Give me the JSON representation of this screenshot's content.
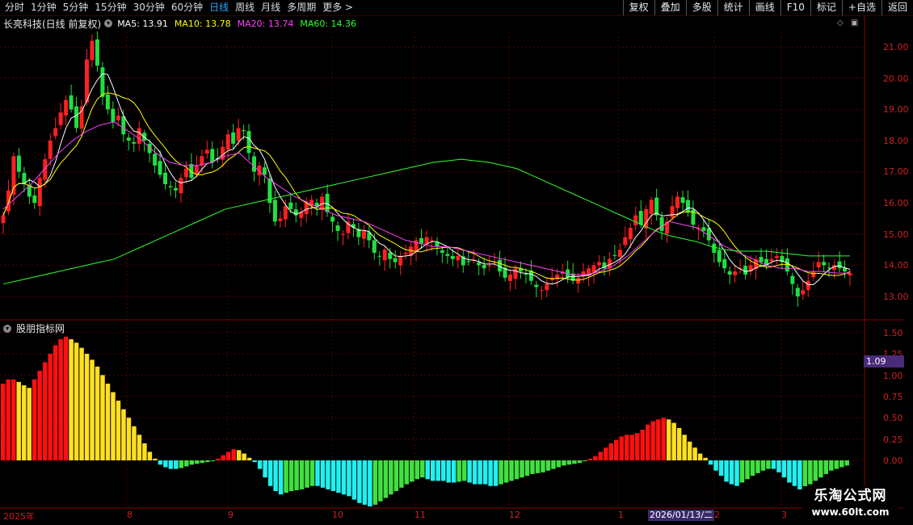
{
  "toolbar": {
    "periods": [
      "分时",
      "1分钟",
      "5分钟",
      "15分钟",
      "30分钟",
      "60分钟",
      "日线",
      "周线",
      "月线",
      "多周期",
      "更多"
    ],
    "active_period": "日线",
    "more_arrow": ">",
    "actions": [
      "复权",
      "叠加",
      "多股",
      "统计",
      "画线",
      "F10",
      "标记",
      "+自选",
      "返回"
    ]
  },
  "info": {
    "stock_name": "长亮科技(日线 前复权)",
    "ma5": "MA5: 13.91",
    "ma10": "MA10: 13.78",
    "ma20": "MA20: 13.74",
    "ma60": "MA60: 14.36",
    "colors": {
      "ma5": "#ffffff",
      "ma10": "#ffff00",
      "ma20": "#ff40ff",
      "ma60": "#30ff30"
    }
  },
  "price_axis": {
    "ticks": [
      "21.00",
      "20.00",
      "19.00",
      "18.00",
      "17.00",
      "16.00",
      "15.00",
      "14.00",
      "13.00"
    ]
  },
  "indicator": {
    "title": "股朋指标网",
    "current_value": "1.09",
    "ticks": [
      "1.50",
      "1.25",
      "1.00",
      "0.75",
      "0.50",
      "0.25",
      "0.00"
    ]
  },
  "date_axis": {
    "labels": [
      "2025年",
      "8",
      "9",
      "10",
      "11",
      "12",
      "1",
      "2",
      "3"
    ],
    "cursor_date": "2026/01/13/二"
  },
  "watermark": {
    "line1": "乐淘公式网",
    "line2": "www.60lt.com"
  },
  "chart_data": {
    "type": "candlestick",
    "colors": {
      "up": "#ff2020",
      "down": "#20e040",
      "ind_red": "#ff1010",
      "ind_yellow": "#ffe020",
      "ind_cyan": "#20f0f0",
      "ind_green": "#40e040"
    },
    "price_range": [
      12.7,
      21.6
    ],
    "closes": [
      15.6,
      16.4,
      17.5,
      17.0,
      16.6,
      16.2,
      16.0,
      16.8,
      17.4,
      18.0,
      18.4,
      18.9,
      19.3,
      19.0,
      18.4,
      19.1,
      20.6,
      21.2,
      20.4,
      19.4,
      19.0,
      18.6,
      18.8,
      18.2,
      18.0,
      17.9,
      18.4,
      18.0,
      17.6,
      17.2,
      16.9,
      16.6,
      16.5,
      16.4,
      16.8,
      17.1,
      16.8,
      17.2,
      17.5,
      17.7,
      17.3,
      17.4,
      17.8,
      18.2,
      17.9,
      18.4,
      18.3,
      17.6,
      17.0,
      17.2,
      16.9,
      16.0,
      15.4,
      15.5,
      15.9,
      15.8,
      15.6,
      15.7,
      16.0,
      16.1,
      15.9,
      16.2,
      15.7,
      15.4,
      15.1,
      15.0,
      15.4,
      15.2,
      14.9,
      15.1,
      14.8,
      14.4,
      14.3,
      14.5,
      14.2,
      14.1,
      14.3,
      14.4,
      14.6,
      14.8,
      14.7,
      14.9,
      14.8,
      14.6,
      14.4,
      14.3,
      14.2,
      14.3,
      14.0,
      14.1,
      14.2,
      14.0,
      13.9,
      14.0,
      14.1,
      13.8,
      13.6,
      13.7,
      13.9,
      13.8,
      13.7,
      13.5,
      13.3,
      13.2,
      13.4,
      13.6,
      13.7,
      13.8,
      13.6,
      13.5,
      13.6,
      13.8,
      13.9,
      14.0,
      14.1,
      13.9,
      14.2,
      14.3,
      14.5,
      14.9,
      15.2,
      15.6,
      15.3,
      15.8,
      16.1,
      15.6,
      15.1,
      15.4,
      15.9,
      16.2,
      16.0,
      15.7,
      15.3,
      15.2,
      15.1,
      14.8,
      14.4,
      14.1,
      13.9,
      13.7,
      13.8,
      13.9,
      13.7,
      14.0,
      14.2,
      14.1,
      14.0,
      14.2,
      14.3,
      14.1,
      13.8,
      13.4,
      13.0,
      13.2,
      13.5,
      13.8,
      14.1,
      14.0,
      13.9,
      14.0,
      13.9,
      13.8,
      13.75
    ],
    "ma60": [
      13.4,
      13.5,
      13.6,
      13.7,
      13.8,
      13.9,
      14.0,
      14.1,
      14.2,
      14.4,
      14.6,
      14.8,
      15.0,
      15.2,
      15.4,
      15.6,
      15.8,
      15.9,
      16.0,
      16.1,
      16.2,
      16.3,
      16.4,
      16.5,
      16.6,
      16.7,
      16.8,
      16.9,
      17.0,
      17.1,
      17.2,
      17.3,
      17.35,
      17.4,
      17.35,
      17.3,
      17.2,
      17.1,
      16.9,
      16.7,
      16.5,
      16.3,
      16.1,
      15.9,
      15.7,
      15.5,
      15.3,
      15.1,
      14.95,
      14.85,
      14.75,
      14.6,
      14.5,
      14.45,
      14.45,
      14.45,
      14.4,
      14.35,
      14.3,
      14.3,
      14.3,
      14.3
    ],
    "ma20": [
      15.8,
      16.2,
      16.6,
      17.1,
      17.6,
      18.0,
      18.3,
      18.5,
      18.6,
      18.3,
      18.0,
      17.6,
      17.3,
      17.2,
      17.2,
      17.3,
      17.5,
      17.6,
      17.2,
      16.8,
      16.5,
      16.2,
      16.0,
      15.8,
      15.6,
      15.5,
      15.4,
      15.2,
      15.0,
      14.8,
      14.7,
      14.6,
      14.6,
      14.5,
      14.4,
      14.3,
      14.2,
      14.1,
      14.0,
      13.9,
      13.8,
      13.7,
      13.7,
      13.8,
      14.0,
      14.3,
      14.7,
      15.1,
      15.4,
      15.3,
      15.2,
      14.9,
      14.6,
      14.4,
      14.2,
      14.0,
      13.9,
      13.9,
      13.8,
      13.8,
      13.75,
      13.74
    ],
    "indicator_values": [
      0.9,
      0.95,
      0.95,
      0.92,
      0.88,
      0.85,
      0.95,
      1.05,
      1.15,
      1.25,
      1.35,
      1.42,
      1.45,
      1.42,
      1.38,
      1.32,
      1.25,
      1.18,
      1.1,
      1.0,
      0.9,
      0.8,
      0.7,
      0.6,
      0.5,
      0.4,
      0.3,
      0.2,
      0.1,
      0.02,
      -0.05,
      -0.08,
      -0.1,
      -0.1,
      -0.09,
      -0.07,
      -0.05,
      -0.04,
      -0.03,
      -0.02,
      -0.01,
      0.02,
      0.06,
      0.1,
      0.13,
      0.12,
      0.08,
      0.03,
      -0.02,
      -0.1,
      -0.2,
      -0.3,
      -0.36,
      -0.4,
      -0.38,
      -0.36,
      -0.35,
      -0.34,
      -0.32,
      -0.3,
      -0.3,
      -0.32,
      -0.34,
      -0.36,
      -0.38,
      -0.4,
      -0.42,
      -0.46,
      -0.5,
      -0.52,
      -0.54,
      -0.52,
      -0.48,
      -0.44,
      -0.4,
      -0.36,
      -0.32,
      -0.28,
      -0.25,
      -0.22,
      -0.2,
      -0.22,
      -0.24,
      -0.24,
      -0.24,
      -0.26,
      -0.26,
      -0.25,
      -0.24,
      -0.26,
      -0.28,
      -0.28,
      -0.28,
      -0.3,
      -0.3,
      -0.28,
      -0.26,
      -0.24,
      -0.22,
      -0.2,
      -0.18,
      -0.16,
      -0.15,
      -0.14,
      -0.12,
      -0.1,
      -0.08,
      -0.06,
      -0.05,
      -0.04,
      -0.03,
      -0.01,
      0.02,
      0.05,
      0.1,
      0.15,
      0.2,
      0.24,
      0.28,
      0.3,
      0.3,
      0.32,
      0.36,
      0.42,
      0.46,
      0.48,
      0.5,
      0.48,
      0.44,
      0.38,
      0.3,
      0.22,
      0.15,
      0.08,
      0.03,
      -0.05,
      -0.12,
      -0.18,
      -0.25,
      -0.28,
      -0.3,
      -0.26,
      -0.22,
      -0.18,
      -0.15,
      -0.12,
      -0.1,
      -0.1,
      -0.14,
      -0.2,
      -0.26,
      -0.3,
      -0.34,
      -0.32,
      -0.28,
      -0.24,
      -0.2,
      -0.16,
      -0.12,
      -0.1,
      -0.08,
      -0.06
    ]
  }
}
